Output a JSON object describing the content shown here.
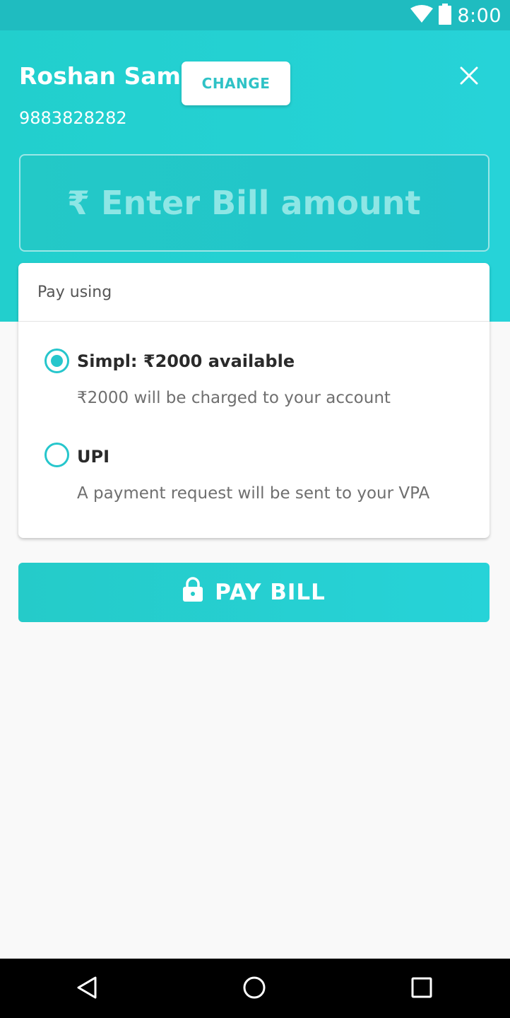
{
  "status_bar": {
    "time": "8:00",
    "icons": [
      "wifi-icon",
      "battery-icon"
    ]
  },
  "header": {
    "user_name": "Roshan Sam",
    "phone": "9883828282",
    "change_label": "CHANGE",
    "close_icon": "close-icon"
  },
  "amount": {
    "currency_symbol": "₹",
    "placeholder": "Enter Bill amount"
  },
  "payment": {
    "title": "Pay using",
    "options": [
      {
        "title": "Simpl: ₹2000 available",
        "description": "₹2000 will be charged to your account",
        "selected": true
      },
      {
        "title": "UPI",
        "description": "A payment request will be sent to your VPA",
        "selected": false
      }
    ]
  },
  "pay_button": {
    "label": "PAY BILL",
    "icon": "lock-icon"
  },
  "navigation": {
    "icons": [
      "back-icon",
      "home-icon",
      "recents-icon"
    ]
  },
  "colors": {
    "accent": "#26d3d8",
    "status_bar": "#1fbcc0",
    "background": "#f9f9f9"
  }
}
